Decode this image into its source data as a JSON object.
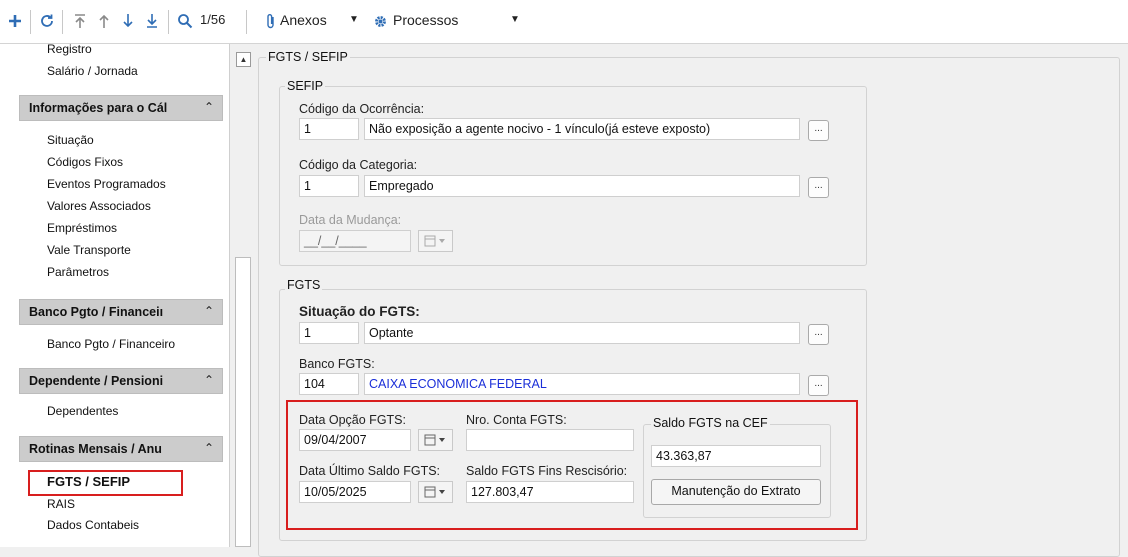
{
  "toolbar": {
    "record_counter": "1/56",
    "anexos_label": "Anexos",
    "processos_label": "Processos"
  },
  "sidebar": {
    "cut_top_item": "Registro",
    "salario_item": "Salário / Jornada",
    "sections": [
      {
        "title": "Informações para o Cál",
        "items": [
          "Situação",
          "Códigos Fixos",
          "Eventos Programados",
          "Valores Associados",
          "Empréstimos",
          "Vale Transporte",
          "Parâmetros"
        ]
      },
      {
        "title": "Banco Pgto / Financeiı",
        "items": [
          "Banco Pgto / Financeiro"
        ]
      },
      {
        "title": "Dependente / Pensioni",
        "items": [
          "Dependentes"
        ]
      },
      {
        "title": "Rotinas Mensais / Anu",
        "items": [
          "FGTS / SEFIP",
          "RAIS",
          "Dados Contabeis"
        ]
      }
    ]
  },
  "main": {
    "outer_title": "FGTS / SEFIP",
    "sefip": {
      "title": "SEFIP",
      "ocorrencia_label": "Código da Ocorrência:",
      "ocorrencia_code": "1",
      "ocorrencia_desc": "Não exposição a agente nocivo - 1 vínculo(já esteve exposto)",
      "categoria_label": "Código da Categoria:",
      "categoria_code": "1",
      "categoria_desc": "Empregado",
      "mudanca_label": "Data da Mudança:",
      "mudanca_value": "__/__/____"
    },
    "fgts": {
      "title": "FGTS",
      "situacao_label": "Situação do FGTS:",
      "situacao_code": "1",
      "situacao_desc": "Optante",
      "banco_label": "Banco FGTS:",
      "banco_code": "104",
      "banco_desc": "CAIXA ECONOMICA FEDERAL",
      "data_opcao_label": "Data Opção FGTS:",
      "data_opcao_value": "09/04/2007",
      "nro_conta_label": "Nro. Conta FGTS:",
      "nro_conta_value": "",
      "data_ultimo_label": "Data Último Saldo FGTS:",
      "data_ultimo_value": "10/05/2025",
      "saldo_fins_label": "Saldo FGTS Fins Rescisório:",
      "saldo_fins_value": "127.803,47",
      "saldo_cef_title": "Saldo FGTS na CEF",
      "saldo_cef_value": "43.363,87",
      "manutencao_button": "Manutenção do Extrato"
    }
  },
  "dots_label": "...",
  "colors": {
    "highlight": "#d81e1e",
    "link_blue": "#1a2ed8",
    "toolbar_icon": "#2f6db5"
  }
}
